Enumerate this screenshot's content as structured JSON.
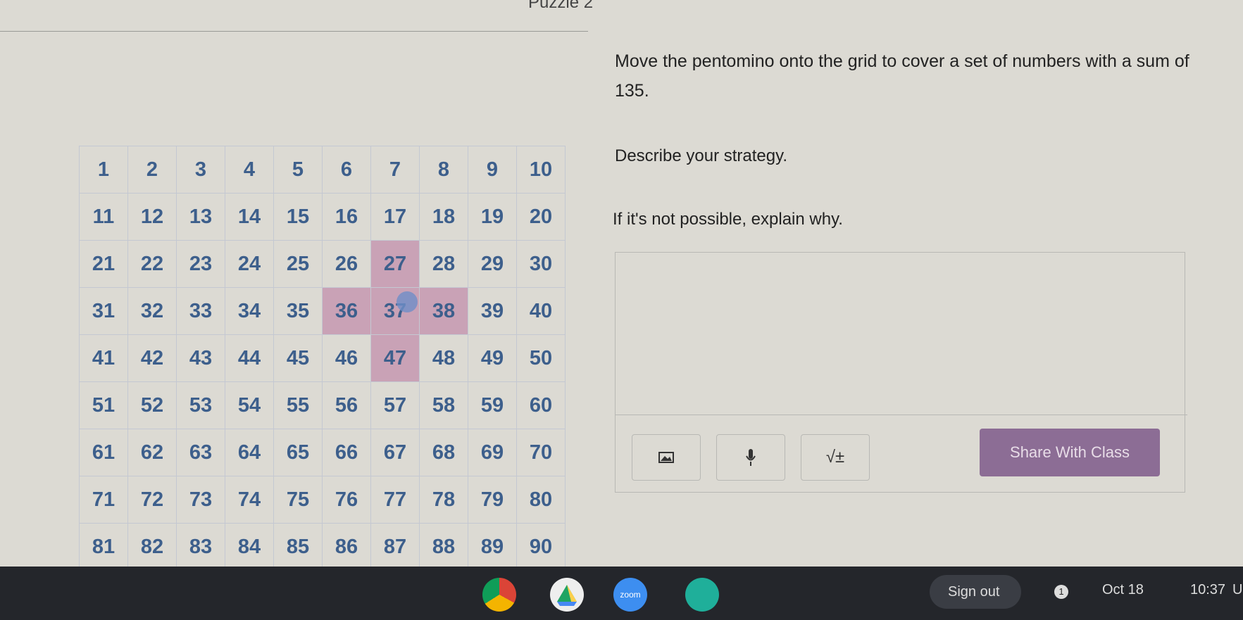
{
  "title": "Puzzle 2",
  "grid": {
    "numbers": [
      1,
      2,
      3,
      4,
      5,
      6,
      7,
      8,
      9,
      10,
      11,
      12,
      13,
      14,
      15,
      16,
      17,
      18,
      19,
      20,
      21,
      22,
      23,
      24,
      25,
      26,
      27,
      28,
      29,
      30,
      31,
      32,
      33,
      34,
      35,
      36,
      37,
      38,
      39,
      40,
      41,
      42,
      43,
      44,
      45,
      46,
      47,
      48,
      49,
      50,
      51,
      52,
      53,
      54,
      55,
      56,
      57,
      58,
      59,
      60,
      61,
      62,
      63,
      64,
      65,
      66,
      67,
      68,
      69,
      70,
      71,
      72,
      73,
      74,
      75,
      76,
      77,
      78,
      79,
      80,
      81,
      82,
      83,
      84,
      85,
      86,
      87,
      88,
      89,
      90
    ],
    "highlighted": [
      27,
      36,
      37,
      38,
      47
    ],
    "highlight_color": "#c9a2b6"
  },
  "prompt": {
    "line1": "Move the pentomino onto the grid to cover a set of numbers with a sum of 135.",
    "line2": "Describe your strategy.",
    "line3": "If it's not possible, explain why."
  },
  "response": {
    "value": "",
    "image_icon": "image-icon",
    "mic_icon": "microphone-icon",
    "math_label": "√±",
    "share_label": "Share With Class",
    "share_color": "#8c6d95"
  },
  "taskbar": {
    "apps": [
      "chrome",
      "google-drive",
      "zoom",
      "classroom"
    ],
    "zoom_label": "zoom",
    "sign_out": "Sign out",
    "notification_count": "1",
    "date": "Oct 18",
    "time": "10:37",
    "locale": "US"
  }
}
